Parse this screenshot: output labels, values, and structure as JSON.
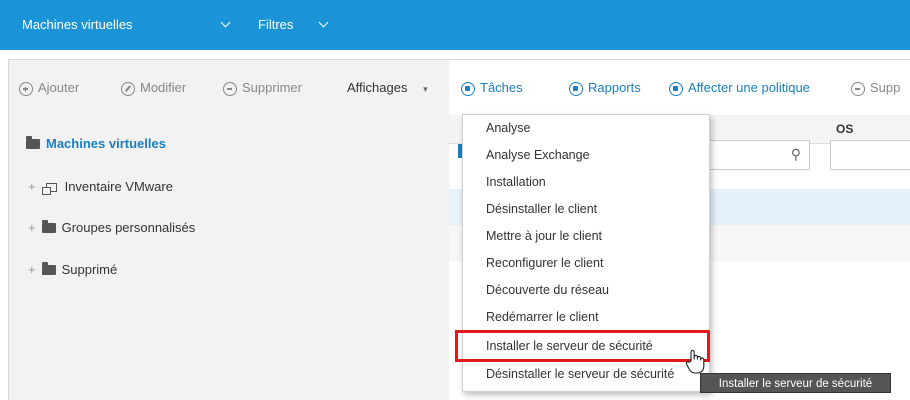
{
  "topbar": {
    "scope_label": "Machines virtuelles",
    "filters_label": "Filtres",
    "background_color": "#1a94d6"
  },
  "left_toolbar": {
    "add_label": "Ajouter",
    "edit_label": "Modifier",
    "delete_label": "Supprimer",
    "views_label": "Affichages"
  },
  "tree": {
    "root_label": "Machines virtuelles",
    "items": [
      {
        "label": "Inventaire VMware",
        "icon": "vm-inventory-icon"
      },
      {
        "label": "Groupes personnalisés",
        "icon": "folder-icon"
      },
      {
        "label": "Supprimé",
        "icon": "folder-icon"
      }
    ]
  },
  "right_toolbar": {
    "tasks_label": "Tâches",
    "reports_label": "Rapports",
    "assign_policy_label": "Affecter une politique",
    "delete_label_partial": "Supp"
  },
  "table": {
    "os_column_header": "OS"
  },
  "tasks_menu": {
    "items": [
      "Analyse",
      "Analyse Exchange",
      "Installation",
      "Désinstaller le client",
      "Mettre à jour le client",
      "Reconfigurer le client",
      "Découverte du réseau",
      "Redémarrer le client",
      "Installer le serveur de sécurité",
      "Désinstaller le serveur de sécurité"
    ],
    "highlighted_index": 8,
    "highlight_color": "#e0191b"
  },
  "tooltip": {
    "text": "Installer le serveur de sécurité"
  }
}
